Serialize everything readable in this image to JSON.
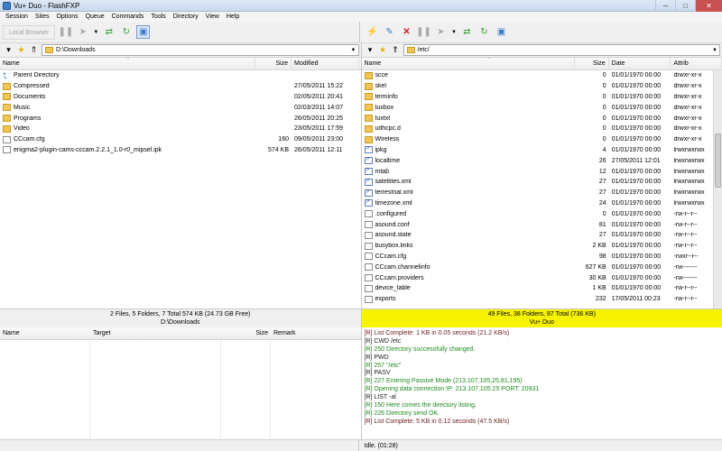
{
  "window": {
    "title": "Vu+ Duo - FlashFXP",
    "minimize": "─",
    "maximize": "□",
    "close": "✕"
  },
  "menu": [
    "Session",
    "Sites",
    "Options",
    "Queue",
    "Commands",
    "Tools",
    "Directory",
    "View",
    "Help"
  ],
  "left_toolbar": {
    "local_browser_label": "Local Browser"
  },
  "left_panel": {
    "path": "D:\\Downloads",
    "columns": {
      "name": "Name",
      "size": "Size",
      "modified": "Modified"
    },
    "rows": [
      {
        "name": "Parent Directory",
        "size": "",
        "modified": "",
        "icon": "up-icon"
      },
      {
        "name": "Compressed",
        "size": "",
        "modified": "27/05/2011 15:22",
        "icon": "folder-icon"
      },
      {
        "name": "Documents",
        "size": "",
        "modified": "02/05/2011 20:41",
        "icon": "folder-icon"
      },
      {
        "name": "Music",
        "size": "",
        "modified": "02/03/2011 14:07",
        "icon": "folder-icon"
      },
      {
        "name": "Programs",
        "size": "",
        "modified": "26/05/2011 20:25",
        "icon": "folder-icon"
      },
      {
        "name": "Video",
        "size": "",
        "modified": "23/05/2011 17:59",
        "icon": "folder-icon"
      },
      {
        "name": "CCcam.cfg",
        "size": "160",
        "modified": "09/05/2011 23:00",
        "icon": "file-icon"
      },
      {
        "name": "enigma2-plugin-cams-cccam.2.2.1_1.0-r0_mipsel.ipk",
        "size": "574 KB",
        "modified": "26/05/2011 12:11",
        "icon": "file-icon"
      }
    ],
    "status_line1": "2 Files, 5 Folders, 7 Total 574 KB (24.73 GB Free)",
    "status_line2": "D:\\Downloads"
  },
  "right_panel": {
    "path": "/etc/",
    "columns": {
      "name": "Name",
      "size": "Size",
      "date": "Date",
      "attrib": "Attrib"
    },
    "rows": [
      {
        "name": "scce",
        "size": "0",
        "date": "01/01/1970 00:00",
        "attrib": "drwxr-xr-x",
        "icon": "folder-icon"
      },
      {
        "name": "skel",
        "size": "0",
        "date": "01/01/1970 00:00",
        "attrib": "drwxr-xr-x",
        "icon": "folder-icon"
      },
      {
        "name": "terminfo",
        "size": "0",
        "date": "01/01/1970 00:00",
        "attrib": "drwxr-xr-x",
        "icon": "folder-icon"
      },
      {
        "name": "tuxbox",
        "size": "0",
        "date": "01/01/1970 00:00",
        "attrib": "drwxr-xr-x",
        "icon": "folder-icon"
      },
      {
        "name": "tuxtxt",
        "size": "0",
        "date": "01/01/1970 00:00",
        "attrib": "drwxr-xr-x",
        "icon": "folder-icon"
      },
      {
        "name": "udhcpc.d",
        "size": "0",
        "date": "01/01/1970 00:00",
        "attrib": "drwxr-xr-x",
        "icon": "folder-icon"
      },
      {
        "name": "Wireless",
        "size": "0",
        "date": "01/01/1970 00:00",
        "attrib": "drwxr-xr-x",
        "icon": "folder-icon"
      },
      {
        "name": "ipkg",
        "size": "4",
        "date": "01/01/1970 00:00",
        "attrib": "lrwxrwxrwx",
        "icon": "link-icon"
      },
      {
        "name": "localtime",
        "size": "26",
        "date": "27/05/2011 12:01",
        "attrib": "lrwxrwxrwx",
        "icon": "link-icon"
      },
      {
        "name": "mtab",
        "size": "12",
        "date": "01/01/1970 00:00",
        "attrib": "lrwxrwxrwx",
        "icon": "link-icon"
      },
      {
        "name": "satellites.xml",
        "size": "27",
        "date": "01/01/1970 00:00",
        "attrib": "lrwxrwxrwx",
        "icon": "link-icon"
      },
      {
        "name": "terrestrial.xml",
        "size": "27",
        "date": "01/01/1970 00:00",
        "attrib": "lrwxrwxrwx",
        "icon": "link-icon"
      },
      {
        "name": "timezone.xml",
        "size": "24",
        "date": "01/01/1970 00:00",
        "attrib": "lrwxrwxrwx",
        "icon": "link-icon"
      },
      {
        "name": ".configured",
        "size": "0",
        "date": "01/01/1970 00:00",
        "attrib": "-rw-r--r--",
        "icon": "file-icon"
      },
      {
        "name": "asound.conf",
        "size": "81",
        "date": "01/01/1970 00:00",
        "attrib": "-rw-r--r--",
        "icon": "file-icon"
      },
      {
        "name": "asound.state",
        "size": "27",
        "date": "01/01/1970 00:00",
        "attrib": "-rw-r--r--",
        "icon": "file-icon"
      },
      {
        "name": "busybox.links",
        "size": "2 KB",
        "date": "01/01/1970 00:00",
        "attrib": "-rw-r--r--",
        "icon": "file-icon"
      },
      {
        "name": "CCcam.cfg",
        "size": "98",
        "date": "01/01/1970 00:00",
        "attrib": "-rwxr--r--",
        "icon": "file-icon"
      },
      {
        "name": "CCcam.channelinfo",
        "size": "627 KB",
        "date": "01/01/1970 00:00",
        "attrib": "-rw-------",
        "icon": "file-icon"
      },
      {
        "name": "CCcam.providers",
        "size": "30 KB",
        "date": "01/01/1970 00:00",
        "attrib": "-rw-------",
        "icon": "file-icon"
      },
      {
        "name": "device_table",
        "size": "1 KB",
        "date": "01/01/1970 00:00",
        "attrib": "-rw-r--r--",
        "icon": "file-icon"
      },
      {
        "name": "exports",
        "size": "232",
        "date": "17/05/2011 00:23",
        "attrib": "-rw-r--r--",
        "icon": "file-icon"
      }
    ],
    "status_line1": "49 Files, 38 Folders, 87 Total (736 KB)",
    "status_line2": "Vu+ Duo"
  },
  "queue": {
    "columns": {
      "name": "Name",
      "target": "Target",
      "size": "Size",
      "remark": "Remark"
    }
  },
  "log": [
    {
      "text": "[R] List Complete: 1 KB in 0.05 seconds (21.2 KB/s)",
      "kind": "dark"
    },
    {
      "text": "[R] CWD /etc",
      "kind": "black"
    },
    {
      "text": "[R] 250 Directory successfully changed.",
      "kind": "green"
    },
    {
      "text": "[R] PWD",
      "kind": "black"
    },
    {
      "text": "[R] 257 \"/etc\"",
      "kind": "green"
    },
    {
      "text": "[R] PASV",
      "kind": "black"
    },
    {
      "text": "[R] 227 Entering Passive Mode (213,107,105,25,81,195)",
      "kind": "green"
    },
    {
      "text": "[R] Opening data connection IP: 213.107.105.25 PORT: 20931",
      "kind": "green"
    },
    {
      "text": "[R] LIST -al",
      "kind": "black"
    },
    {
      "text": "[R] 150 Here comes the directory listing.",
      "kind": "green"
    },
    {
      "text": "[R] 226 Directory send OK.",
      "kind": "green"
    },
    {
      "text": "[R] List Complete: 5 KB in 0.12 seconds (47.5 KB/s)",
      "kind": "dark"
    }
  ],
  "status_bar": {
    "text": "Idle. (01:28)"
  },
  "colors": {
    "remote_status_bg": "#f6f200",
    "log_green": "#1e8a1e"
  }
}
